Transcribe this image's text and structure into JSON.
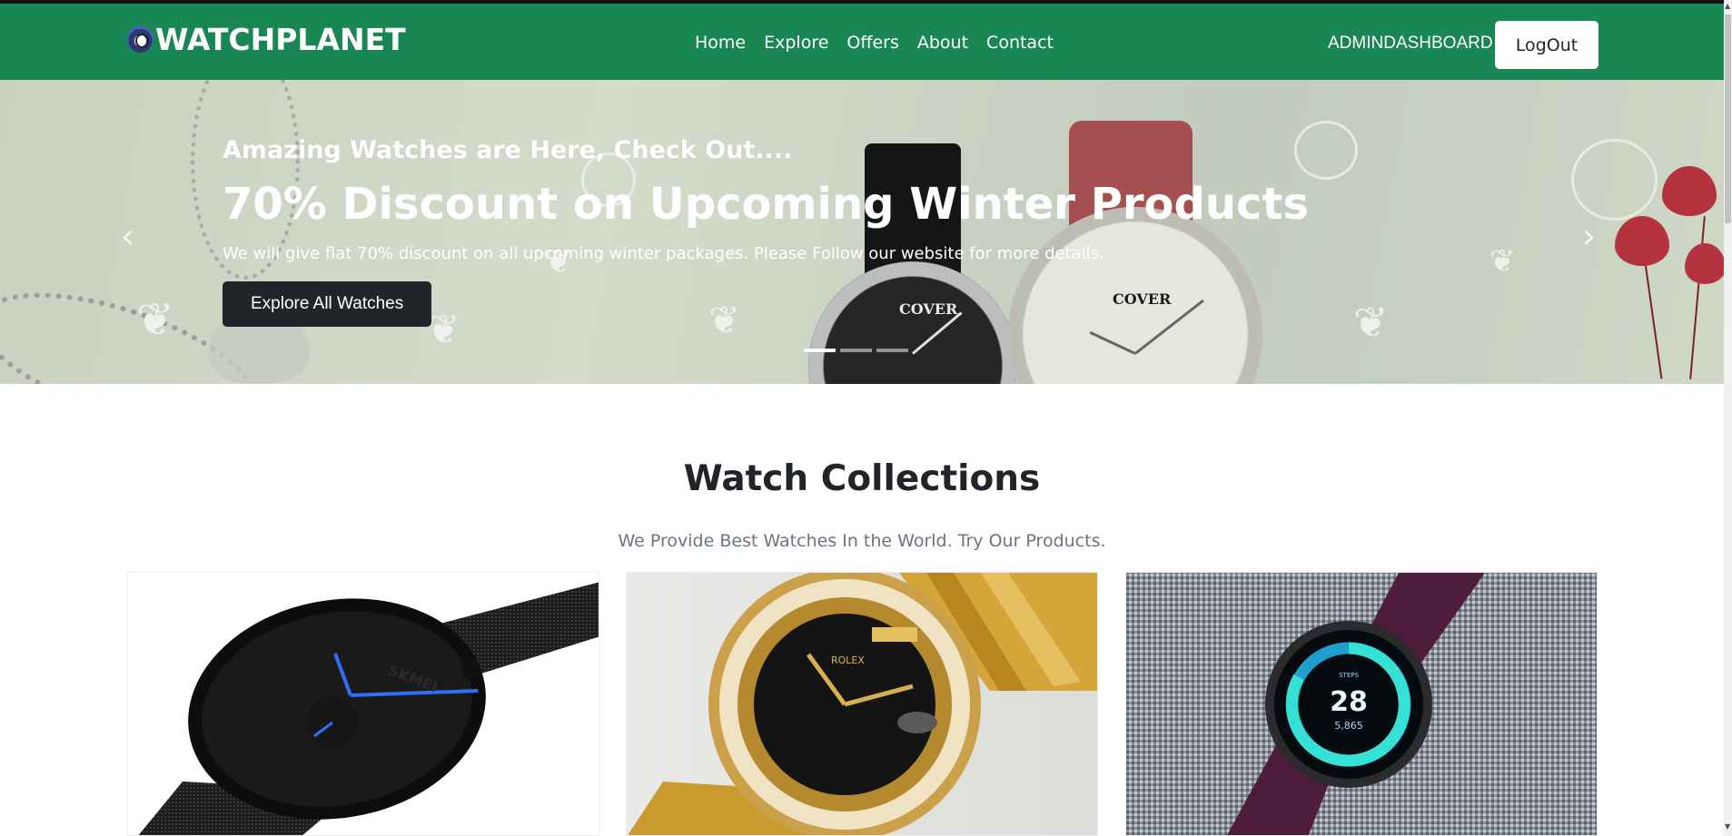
{
  "brand": {
    "name": "WATCHPLANET"
  },
  "nav": {
    "links": [
      "Home",
      "Explore",
      "Offers",
      "About",
      "Contact"
    ],
    "admin": "ADMINDASHBOARD",
    "logout": "LogOut"
  },
  "hero": {
    "subtitle": "Amazing Watches are Here, Check Out....",
    "title": "70% Discount on Upcoming Winter Products",
    "description": "We will give flat 70% discount on all upcoming winter packages. Please Follow our website for more details.",
    "button": "Explore All Watches",
    "watch_brand_left": "COVER",
    "watch_brand_right": "COVER",
    "slide_count": 3,
    "active_slide": 1
  },
  "collections": {
    "title": "Watch Collections",
    "subtitle": "We Provide Best Watches In the World. Try Our Products.",
    "cards": [
      {
        "brand": "SKMEI"
      },
      {
        "brand": "ROLEX"
      },
      {
        "steps_label": "STEPS",
        "value": "28",
        "sub_value": "5,865"
      }
    ]
  },
  "colors": {
    "navbar": "#198754",
    "button_dark": "#212529",
    "muted_text": "#6c757d"
  }
}
